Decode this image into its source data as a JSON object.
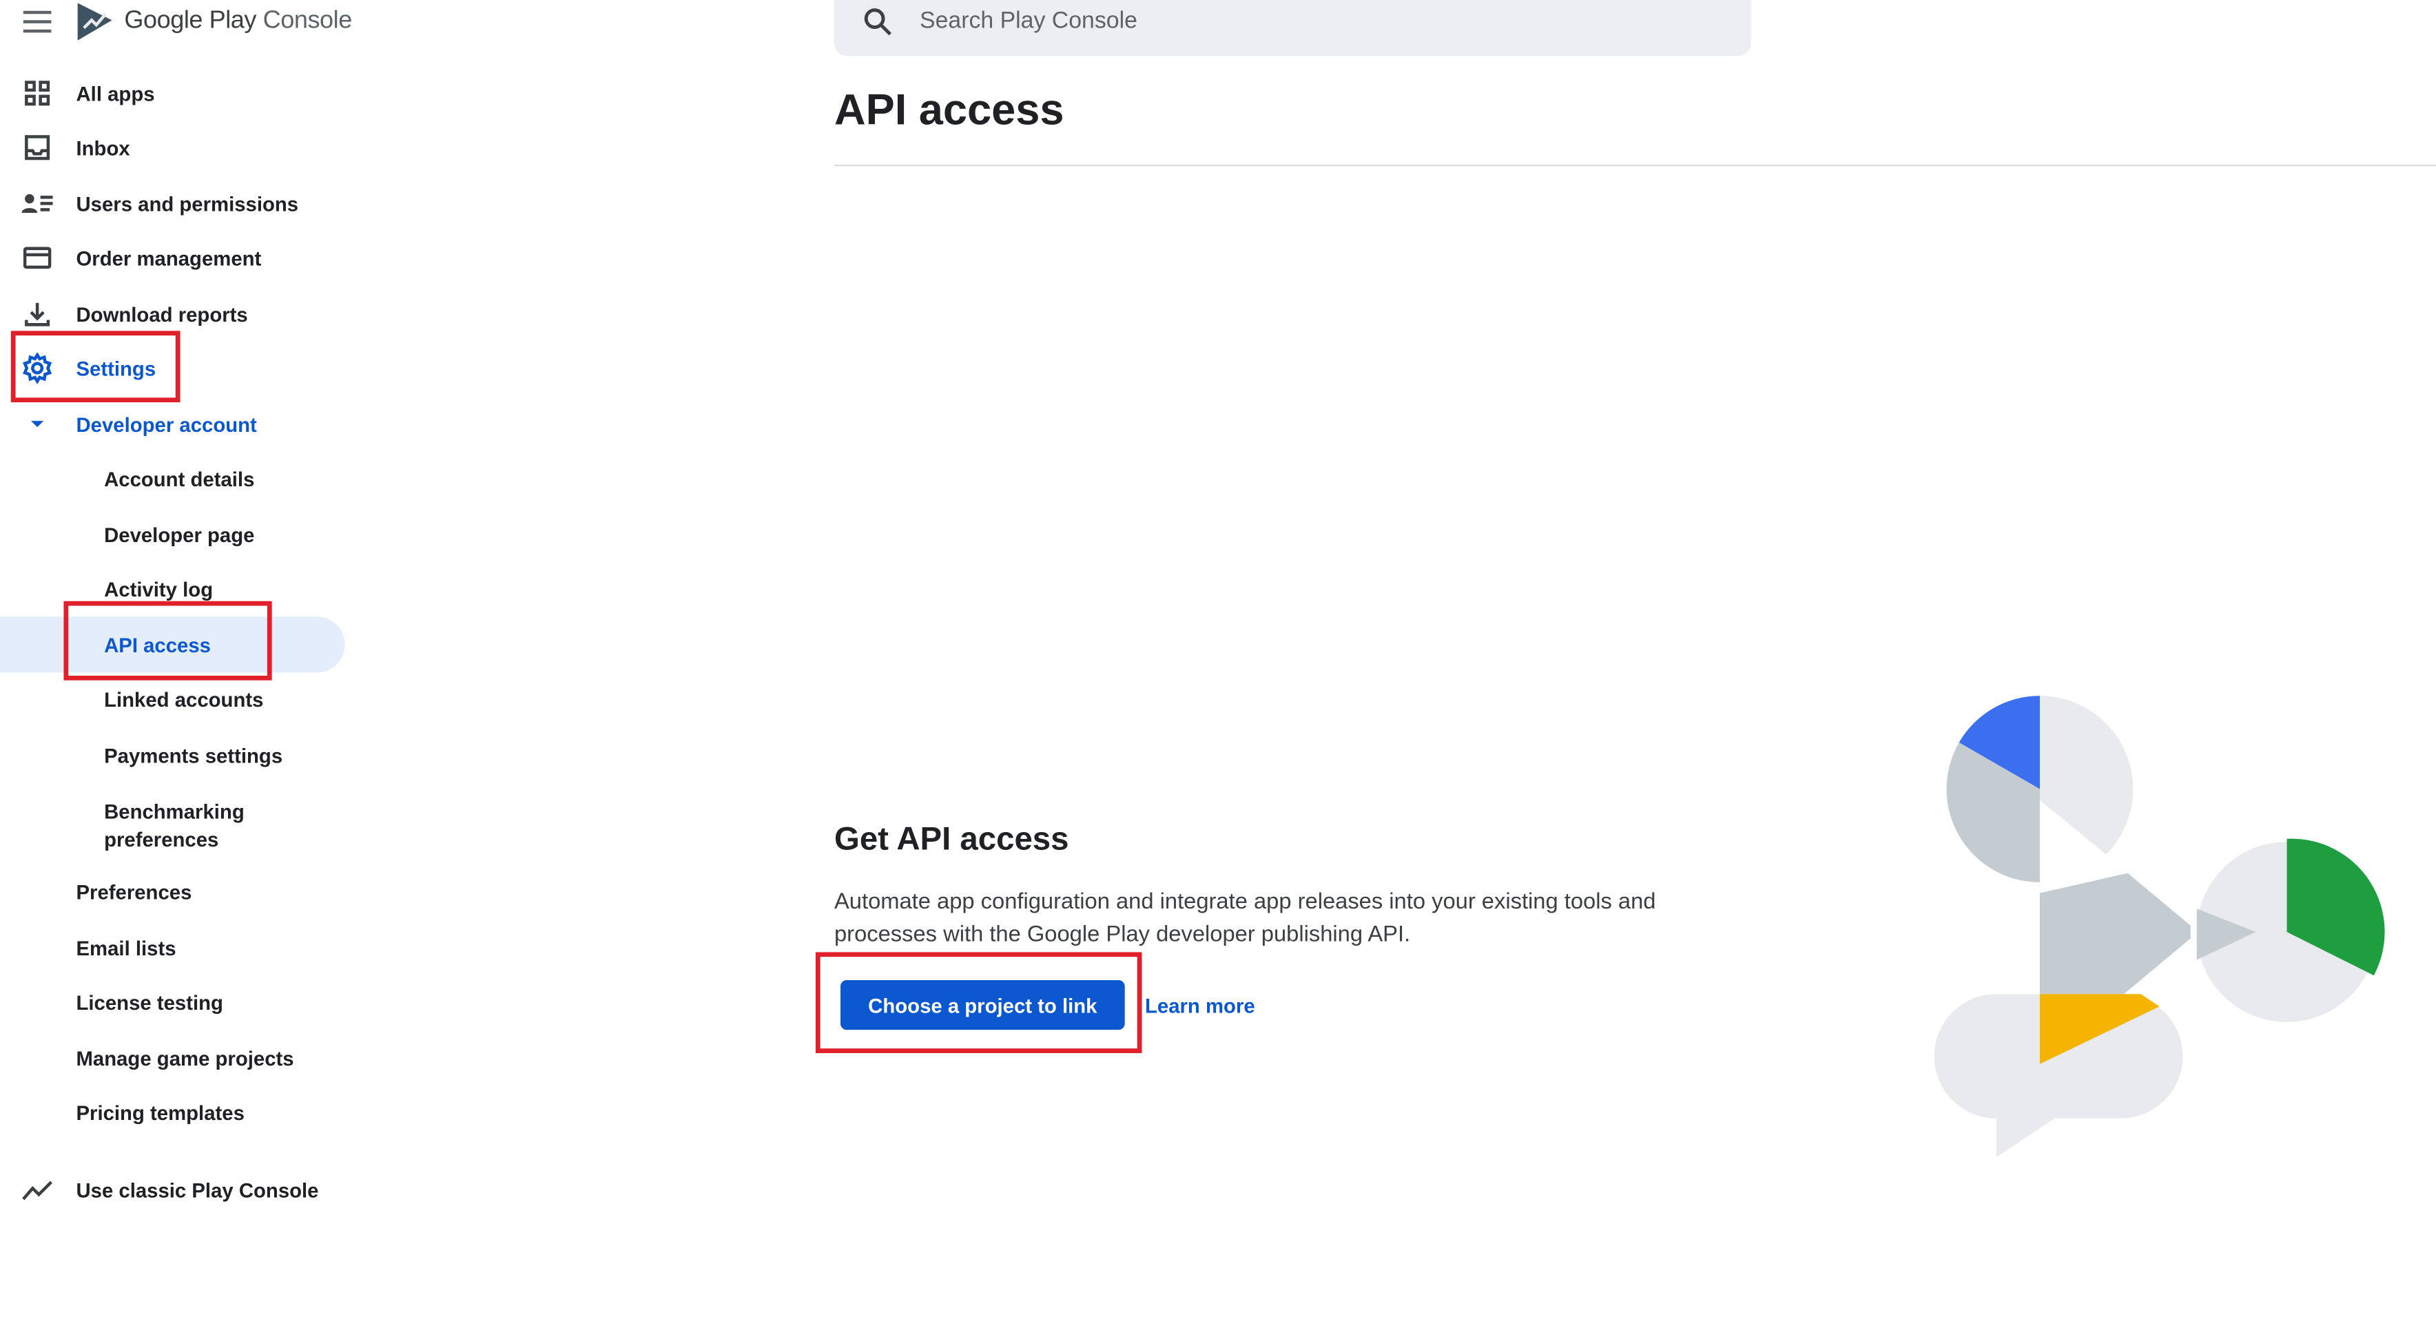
{
  "app": {
    "brand_google": "Google Play",
    "brand_product": "Console"
  },
  "search": {
    "placeholder": "Search Play Console"
  },
  "sidebar": {
    "all_apps": "All apps",
    "inbox": "Inbox",
    "users_permissions": "Users and permissions",
    "order_management": "Order management",
    "download_reports": "Download reports",
    "settings": "Settings",
    "developer_account": "Developer account",
    "sub_items": [
      {
        "label": "Account details"
      },
      {
        "label": "Developer page"
      },
      {
        "label": "Activity log"
      },
      {
        "label": "API access"
      },
      {
        "label": "Linked accounts"
      },
      {
        "label": "Payments settings"
      },
      {
        "label": "Benchmarking preferences"
      }
    ],
    "preferences": "Preferences",
    "email_lists": "Email lists",
    "license_testing": "License testing",
    "manage_game_projects": "Manage game projects",
    "pricing_templates": "Pricing templates",
    "classic_console": "Use classic Play Console"
  },
  "main": {
    "title": "API access",
    "card_title": "Get API access",
    "card_description": "Automate app configuration and integrate app releases into your existing tools and processes with the Google Play developer publishing API.",
    "primary_button": "Choose a project to link",
    "learn_more": "Learn more"
  },
  "colors": {
    "accent": "#0b57d0",
    "highlight_box": "#e0202a",
    "active_bg": "#e3edfb"
  }
}
